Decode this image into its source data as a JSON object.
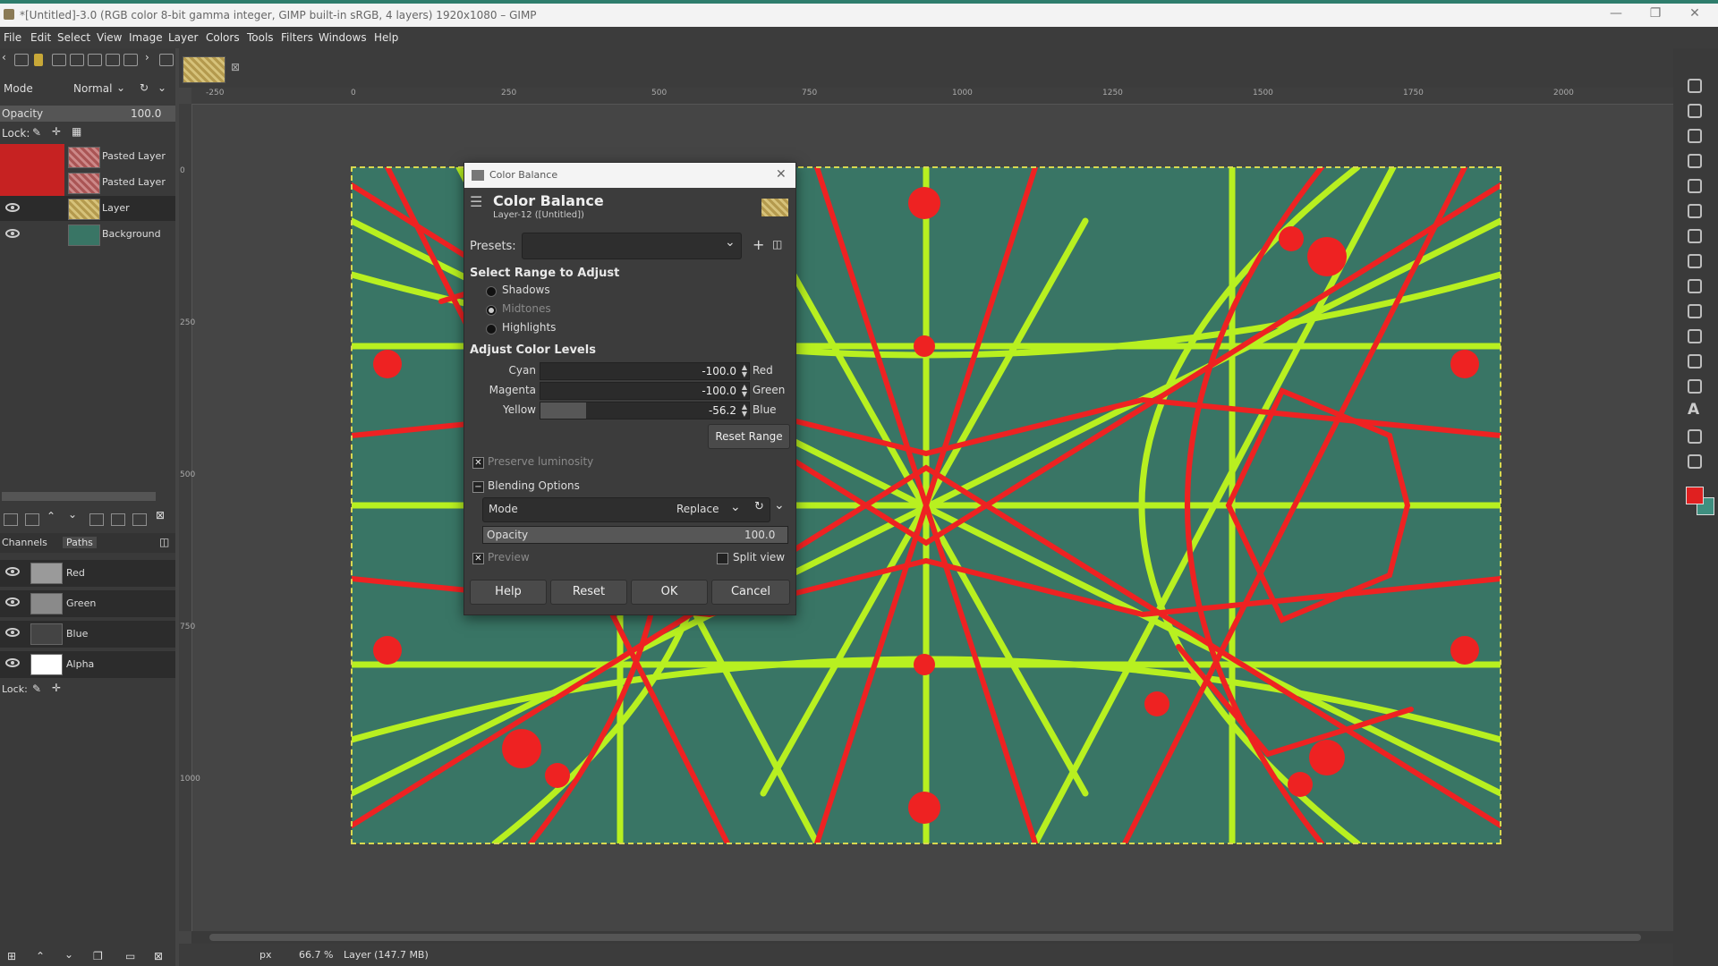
{
  "window": {
    "title": "*[Untitled]-3.0 (RGB color 8-bit gamma integer, GIMP built-in sRGB, 4 layers) 1920x1080 – GIMP",
    "minimize": "—",
    "maximize": "❐",
    "close": "✕"
  },
  "menu": [
    "File",
    "Edit",
    "Select",
    "View",
    "Image",
    "Layer",
    "Colors",
    "Tools",
    "Filters",
    "Windows",
    "Help"
  ],
  "layers_panel": {
    "mode_label": "Mode",
    "mode_value": "Normal",
    "opacity_label": "Opacity",
    "opacity_value": "100.0",
    "lock_label": "Lock:",
    "layers": [
      {
        "name": "Pasted Layer",
        "visible": false,
        "thumb": "checker-red"
      },
      {
        "name": "Pasted Layer",
        "visible": false,
        "thumb": "checker-red"
      },
      {
        "name": "Layer",
        "visible": true,
        "thumb": "gold"
      },
      {
        "name": "Background",
        "visible": true,
        "thumb": "teal"
      }
    ]
  },
  "channels_panel": {
    "tab_channels": "Channels",
    "tab_paths": "Paths",
    "channels": [
      "Red",
      "Green",
      "Blue",
      "Alpha"
    ],
    "lock_label": "Lock:"
  },
  "rulers": {
    "top": [
      "-250",
      "0",
      "250",
      "500",
      "750",
      "1000",
      "1250",
      "1500",
      "1750",
      "2000"
    ],
    "left": [
      "0",
      "250",
      "500",
      "750",
      "1000"
    ]
  },
  "statusbar": {
    "unit": "px",
    "zoom": "66.7 %",
    "info": "Layer (147.7 MB)"
  },
  "dialog": {
    "window_title": "Color Balance",
    "heading": "Color Balance",
    "subheading": "Layer-12 ([Untitled])",
    "presets_label": "Presets:",
    "presets_value": "",
    "range_section": "Select Range to Adjust",
    "ranges": [
      {
        "label": "Shadows",
        "selected": false
      },
      {
        "label": "Midtones",
        "selected": true
      },
      {
        "label": "Highlights",
        "selected": false
      }
    ],
    "levels_section": "Adjust Color Levels",
    "levels": [
      {
        "left": "Cyan",
        "right": "Red",
        "value": "-100.0",
        "fraction": 0.0
      },
      {
        "left": "Magenta",
        "right": "Green",
        "value": "-100.0",
        "fraction": 0.0
      },
      {
        "left": "Yellow",
        "right": "Blue",
        "value": "-56.2",
        "fraction": 0.22
      }
    ],
    "reset_range": "Reset Range",
    "preserve_luminosity": "Preserve luminosity",
    "blending_options": "Blending Options",
    "blend_mode_label": "Mode",
    "blend_mode_value": "Replace",
    "blend_opacity_label": "Opacity",
    "blend_opacity_value": "100.0",
    "preview_label": "Preview",
    "split_view_label": "Split view",
    "buttons": {
      "help": "Help",
      "reset": "Reset",
      "ok": "OK",
      "cancel": "Cancel"
    }
  },
  "colors": {
    "canvas_bg": "#397565",
    "pattern_red": "#ee2222",
    "pattern_yellow": "#b8f020",
    "fg_color": "#e02020",
    "bg_color": "#3f8f80"
  }
}
